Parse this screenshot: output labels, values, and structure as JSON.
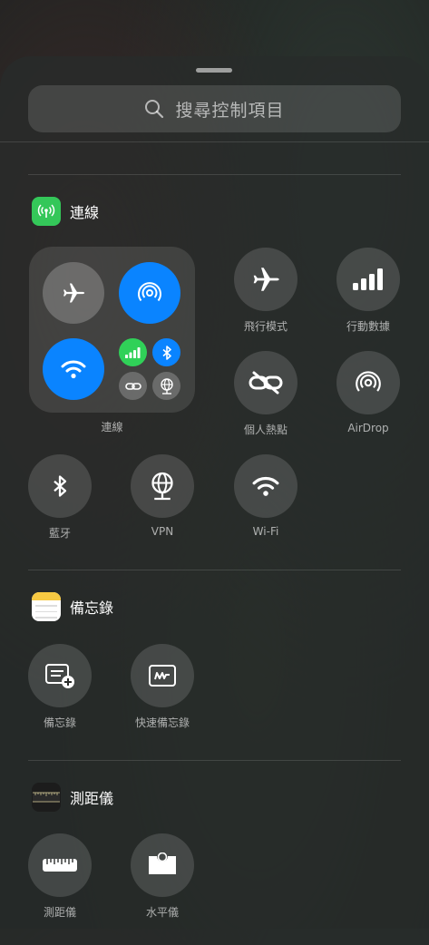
{
  "search": {
    "placeholder": "搜尋控制項目",
    "icon": "search-icon"
  },
  "sections": {
    "connectivity": {
      "title": "連線",
      "app_icon": "antenna-icon",
      "accent": "#34c759",
      "group_label": "連線",
      "group_tiles": [
        {
          "name": "airplane-mode-tile",
          "icon": "airplane-icon",
          "active": false
        },
        {
          "name": "airdrop-tile",
          "icon": "airdrop-icon",
          "active": true
        },
        {
          "name": "wifi-tile",
          "icon": "wifi-icon",
          "active": true
        },
        {
          "name": "cellular-tile",
          "icon": "cellular-bars-icon",
          "active": true
        },
        {
          "name": "bluetooth-tile",
          "icon": "bluetooth-icon",
          "active": true
        },
        {
          "name": "hotspot-tile",
          "icon": "link-icon",
          "active": false
        },
        {
          "name": "vpn-tile",
          "icon": "globe-icon",
          "active": false
        }
      ],
      "controls": [
        {
          "label": "飛行模式",
          "icon": "airplane-icon"
        },
        {
          "label": "行動數據",
          "icon": "cellular-bars-icon"
        },
        {
          "label": "個人熱點",
          "icon": "link-icon"
        },
        {
          "label": "AirDrop",
          "icon": "airdrop-icon"
        },
        {
          "label": "藍牙",
          "icon": "bluetooth-icon"
        },
        {
          "label": "VPN",
          "icon": "globe-icon"
        },
        {
          "label": "Wi-Fi",
          "icon": "wifi-icon"
        }
      ]
    },
    "notes": {
      "title": "備忘錄",
      "app_icon": "notes-app-icon",
      "controls": [
        {
          "label": "備忘錄",
          "icon": "new-note-icon"
        },
        {
          "label": "快速備忘錄",
          "icon": "quick-note-icon"
        }
      ]
    },
    "measure": {
      "title": "測距儀",
      "app_icon": "measure-app-icon",
      "controls": [
        {
          "label": "測距儀",
          "icon": "ruler-icon"
        },
        {
          "label": "水平儀",
          "icon": "level-icon"
        }
      ]
    }
  },
  "colors": {
    "active_blue": "#0a84ff",
    "active_green": "#30d158"
  }
}
